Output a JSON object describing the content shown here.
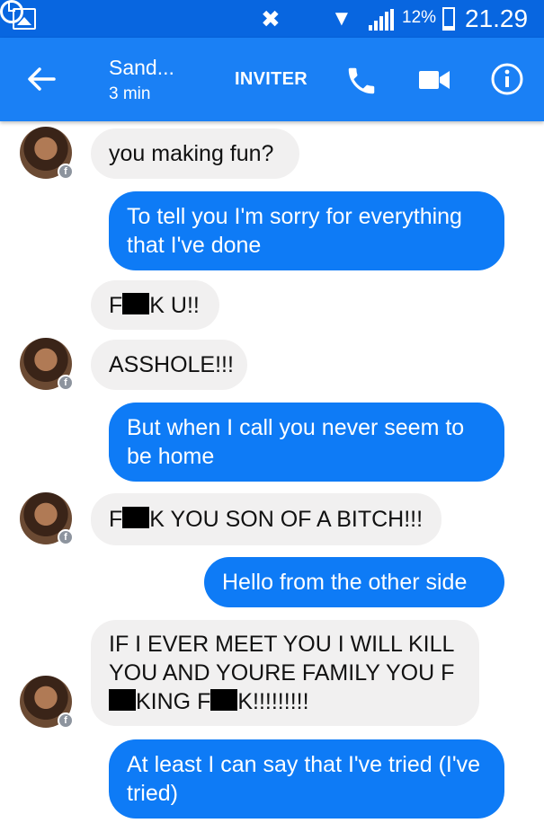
{
  "status_bar": {
    "battery_percent": "12%",
    "time": "21.29",
    "battery_level": 0.12
  },
  "header": {
    "contact_name": "Sand...",
    "contact_status": "3 min",
    "invite_label": "INVITER",
    "icons": [
      "back-arrow-icon",
      "phone-icon",
      "video-camera-icon",
      "info-icon"
    ]
  },
  "messages": [
    {
      "dir": "in",
      "text": "you making fun?"
    },
    {
      "dir": "out",
      "text": "To tell you I'm sorry for everything that I've done"
    },
    {
      "dir": "in",
      "text": "F■K U!!"
    },
    {
      "dir": "in",
      "text": "ASSHOLE!!!"
    },
    {
      "dir": "out",
      "text": "But when I call you never seem to be home"
    },
    {
      "dir": "in",
      "text": "F■K YOU SON OF A BITCH!!!"
    },
    {
      "dir": "out",
      "text": "Hello from the other side"
    },
    {
      "dir": "in",
      "text": "IF I EVER MEET YOU I WILL KILL YOU AND YOURE FAMILY YOU F■KING F■K!!!!!!!!!"
    },
    {
      "dir": "out",
      "text": "At least I can say that I've tried (I've tried)"
    }
  ],
  "colors": {
    "status_bar": "#0866e0",
    "header": "#1a80f5",
    "outgoing_bubble": "#0e7bf6",
    "incoming_bubble": "#f1f0f0"
  }
}
